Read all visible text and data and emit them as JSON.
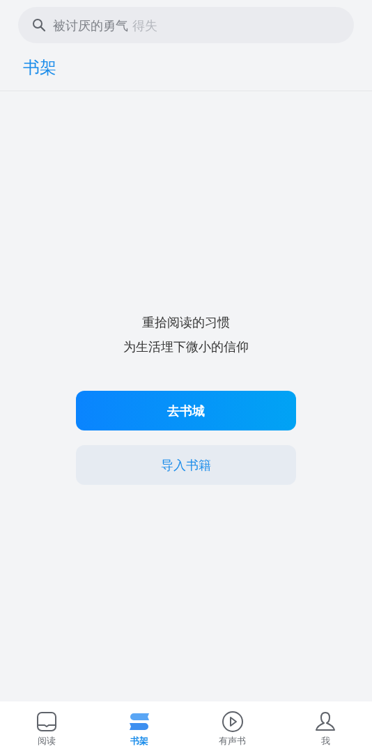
{
  "search": {
    "placeholder": "被讨厌的勇气",
    "fading_text": "得失"
  },
  "title": "书架",
  "empty_message": [
    "重拾阅读的习惯",
    "为生活埋下微小的信仰"
  ],
  "buttons": [
    {
      "label": "去书城",
      "kind": "primary"
    },
    {
      "label": "导入书籍",
      "kind": "secondary"
    }
  ],
  "tabs": [
    {
      "label": "阅读",
      "selected": false
    },
    {
      "label": "书架",
      "selected": true
    },
    {
      "label": "有声书",
      "selected": false
    },
    {
      "label": "我",
      "selected": false
    }
  ]
}
